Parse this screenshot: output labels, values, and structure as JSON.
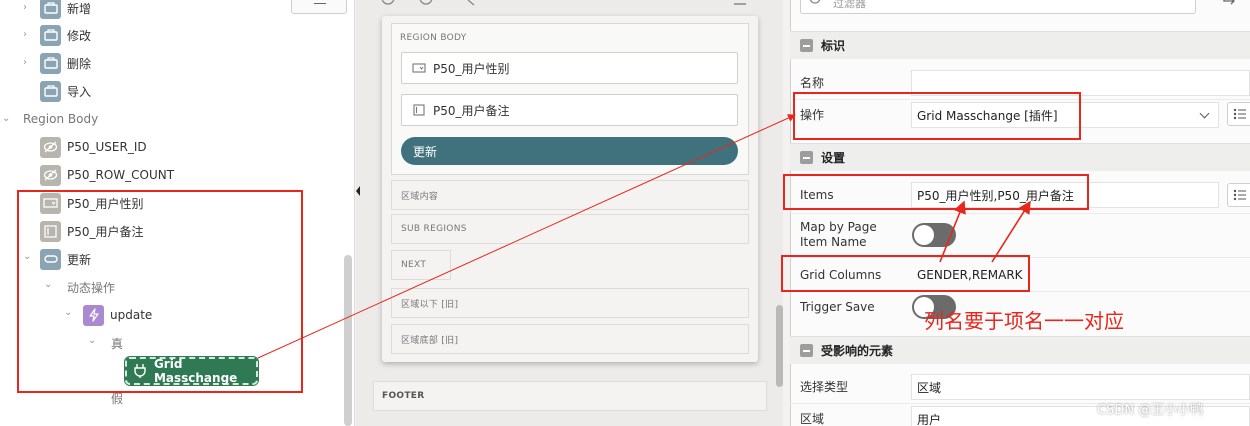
{
  "tree": {
    "buttons": [
      {
        "label": "新增"
      },
      {
        "label": "修改"
      },
      {
        "label": "删除"
      },
      {
        "label": "导入"
      }
    ],
    "region_body": "Region Body",
    "hidden_items": [
      {
        "label": "P50_USER_ID"
      },
      {
        "label": "P50_ROW_COUNT"
      }
    ],
    "page_items": [
      {
        "label": "P50_用户性别"
      },
      {
        "label": "P50_用户备注"
      }
    ],
    "update_button": "更新",
    "dynamic_actions": "动态操作",
    "da_name": "update",
    "true_branch": "真",
    "grid_action": "Grid Masschange",
    "false_branch": "假"
  },
  "layout": {
    "region_body": "REGION BODY",
    "field_gender": "P50_用户性别",
    "field_remark": "P50_用户备注",
    "update_button": "更新",
    "slot_region_content": "区域内容",
    "slot_sub_regions": "SUB REGIONS",
    "slot_next": "NEXT",
    "slot_below": "区域以下 [旧]",
    "slot_bottom": "区域底部 [旧]",
    "footer": "FOOTER"
  },
  "props": {
    "search_placeholder": "过滤器",
    "identification": {
      "title": "标识",
      "name_label": "名称",
      "name_value": "",
      "action_label": "操作",
      "action_value": "Grid Masschange [插件]"
    },
    "settings": {
      "title": "设置",
      "items_label": "Items",
      "items_value": "P50_用户性别,P50_用户备注",
      "map_label": "Map by Page Item Name",
      "grid_columns_label": "Grid Columns",
      "grid_columns_value": "GENDER,REMARK",
      "trigger_save_label": "Trigger Save"
    },
    "affected": {
      "title": "受影响的元素",
      "selection_type_label": "选择类型",
      "selection_type_value": "区域",
      "region_label": "区域",
      "region_value": "用户"
    }
  },
  "annotation": {
    "text": "列名要于项名一一对应",
    "color": "#e8261c"
  },
  "watermark": "CSDN @王小小鸭"
}
